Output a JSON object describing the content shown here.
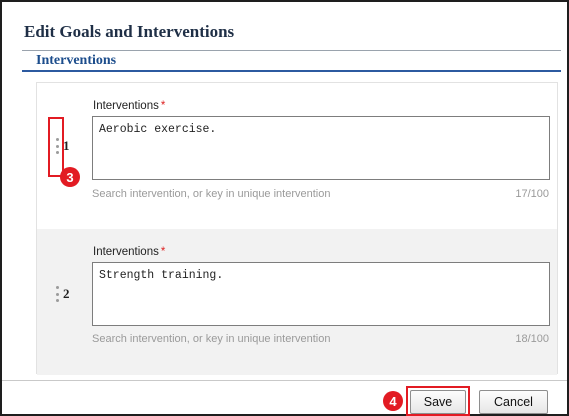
{
  "dialog": {
    "title": "Edit Goals and Interventions",
    "section_title": "Interventions"
  },
  "interventions": [
    {
      "number": "1",
      "label": "Interventions",
      "required_mark": "*",
      "value": "Aerobic exercise.",
      "hint": "Search intervention, or key in unique intervention",
      "counter": "17/100"
    },
    {
      "number": "2",
      "label": "Interventions",
      "required_mark": "*",
      "value": "Strength training.",
      "hint": "Search intervention, or key in unique intervention",
      "counter": "18/100"
    }
  ],
  "annotations": {
    "step_3": "3",
    "step_4": "4",
    "color": "#e21b23"
  },
  "footer": {
    "save_label": "Save",
    "cancel_label": "Cancel"
  }
}
